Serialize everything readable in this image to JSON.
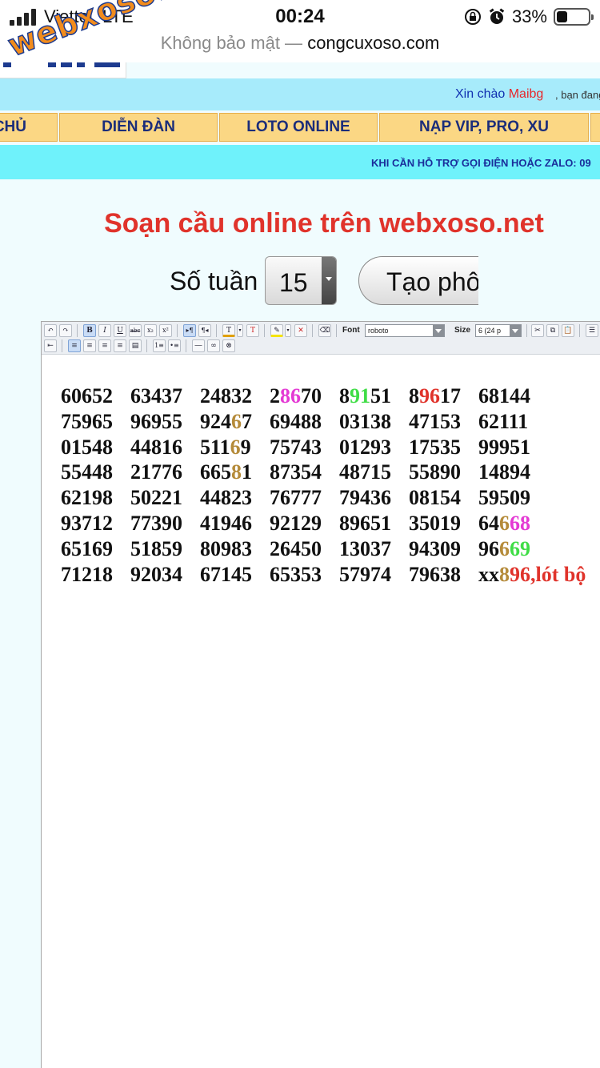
{
  "status_bar": {
    "carrier": "Viettel",
    "network": "LTE",
    "time": "00:24",
    "battery_percent": "33%",
    "battery_level": 0.33
  },
  "browser": {
    "security_text": "Không bảo mật —",
    "domain": "congcuxoso.com"
  },
  "watermark": "webxoso.net",
  "greeting": {
    "hello": "Xin chào",
    "username": "Maibg",
    "tail": ", bạn đang"
  },
  "nav": {
    "items": [
      "CHỦ",
      "DIỄN ĐÀN",
      "LOTO ONLINE",
      "NẠP VIP, PRO, XU"
    ]
  },
  "support_text": "KHI CẦN HỖ TRỢ GỌI ĐIỆN HOẶC ZALO: 09",
  "heading": "Soạn cầu online trên webxoso.net",
  "weeks": {
    "label": "Số tuần",
    "value": "15"
  },
  "create_button": "Tạo phô",
  "editor_toolbar": {
    "font_label": "Font",
    "font_value": "roboto",
    "size_label": "Size",
    "size_value": "6 (24 p"
  },
  "colors": {
    "gold": "#b58b3a",
    "magenta": "#e43ad4",
    "green": "#3fdd46",
    "red": "#e0332b",
    "nav_bg": "#fbd784",
    "support_bg": "#6ff2fb"
  },
  "table": [
    [
      [
        [
          "60652"
        ]
      ],
      [
        [
          "63437"
        ]
      ],
      [
        [
          "24832"
        ]
      ],
      [
        [
          "2"
        ],
        [
          "86",
          "magenta"
        ],
        [
          "70"
        ]
      ],
      [
        [
          "8"
        ],
        [
          "91",
          "green"
        ],
        [
          "51"
        ]
      ],
      [
        [
          "8"
        ],
        [
          "96",
          "red"
        ],
        [
          "17"
        ]
      ],
      [
        [
          "68144"
        ]
      ]
    ],
    [
      [
        [
          "75965"
        ]
      ],
      [
        [
          "96955"
        ]
      ],
      [
        [
          "924"
        ],
        [
          "6",
          "gold"
        ],
        [
          "7"
        ]
      ],
      [
        [
          "69488"
        ]
      ],
      [
        [
          "03138"
        ]
      ],
      [
        [
          "47153"
        ]
      ],
      [
        [
          "62111"
        ]
      ]
    ],
    [
      [
        [
          "01548"
        ]
      ],
      [
        [
          "44816"
        ]
      ],
      [
        [
          "511"
        ],
        [
          "6",
          "gold"
        ],
        [
          "9"
        ]
      ],
      [
        [
          "75743"
        ]
      ],
      [
        [
          "01293"
        ]
      ],
      [
        [
          "17535"
        ]
      ],
      [
        [
          "99951"
        ]
      ]
    ],
    [
      [
        [
          "55448"
        ]
      ],
      [
        [
          "21776"
        ]
      ],
      [
        [
          "665"
        ],
        [
          "8",
          "gold"
        ],
        [
          "1"
        ]
      ],
      [
        [
          "87354"
        ]
      ],
      [
        [
          "48715"
        ]
      ],
      [
        [
          "55890"
        ]
      ],
      [
        [
          "14894"
        ]
      ]
    ],
    [
      [
        [
          "62198"
        ]
      ],
      [
        [
          "50221"
        ]
      ],
      [
        [
          "44823"
        ]
      ],
      [
        [
          "76777"
        ]
      ],
      [
        [
          "79436"
        ]
      ],
      [
        [
          "08154"
        ]
      ],
      [
        [
          "59509"
        ]
      ]
    ],
    [
      [
        [
          "93712"
        ]
      ],
      [
        [
          "77390"
        ]
      ],
      [
        [
          "41946"
        ]
      ],
      [
        [
          "92129"
        ]
      ],
      [
        [
          "89651"
        ]
      ],
      [
        [
          "35019"
        ]
      ],
      [
        [
          "64"
        ],
        [
          "6",
          "gold"
        ],
        [
          "68",
          "magenta"
        ]
      ]
    ],
    [
      [
        [
          "65169"
        ]
      ],
      [
        [
          "51859"
        ]
      ],
      [
        [
          "80983"
        ]
      ],
      [
        [
          "26450"
        ]
      ],
      [
        [
          "13037"
        ]
      ],
      [
        [
          "94309"
        ]
      ],
      [
        [
          "96"
        ],
        [
          "6",
          "gold"
        ],
        [
          "69",
          "green"
        ]
      ]
    ],
    [
      [
        [
          "71218"
        ]
      ],
      [
        [
          "92034"
        ]
      ],
      [
        [
          "67145"
        ]
      ],
      [
        [
          "65353"
        ]
      ],
      [
        [
          "57974"
        ]
      ],
      [
        [
          "79638"
        ]
      ],
      [
        [
          "xx"
        ],
        [
          "8",
          "gold"
        ],
        [
          "96,lót bộ",
          "red"
        ]
      ]
    ]
  ]
}
